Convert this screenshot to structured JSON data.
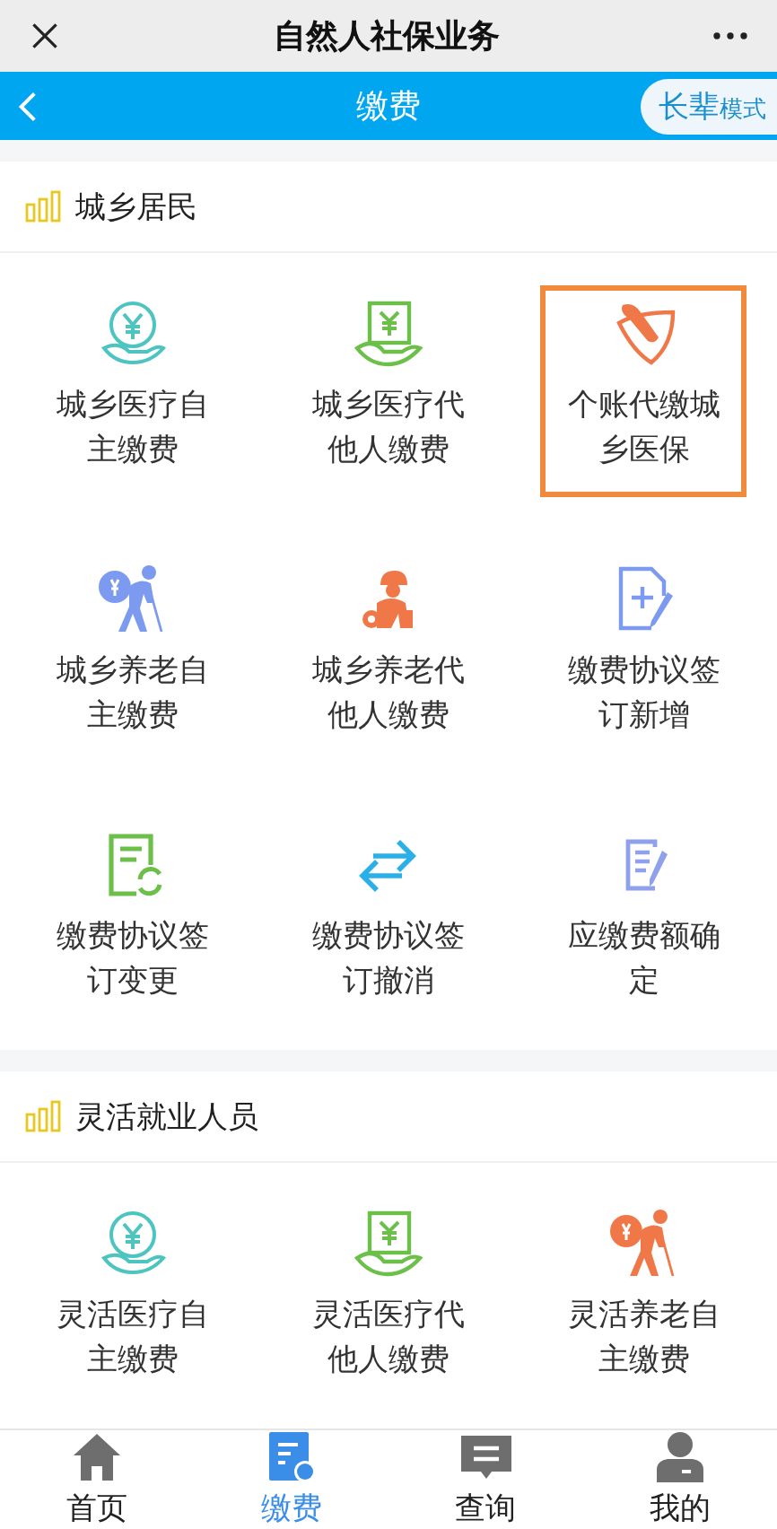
{
  "top_bar": {
    "title": "自然人社保业务"
  },
  "nav_bar": {
    "title": "缴费",
    "mode_button": {
      "big": "长辈",
      "small": "模式"
    }
  },
  "sections": [
    {
      "title": "城乡居民",
      "items": [
        {
          "label": "城乡医疗自主缴费",
          "kind": "yen-hand",
          "highlighted": false
        },
        {
          "label": "城乡医疗代他人缴费",
          "kind": "bill-hand",
          "highlighted": false
        },
        {
          "label": "个账代缴城乡医保",
          "kind": "pen-shield",
          "highlighted": true
        },
        {
          "label": "城乡养老自主缴费",
          "kind": "elder",
          "highlighted": false
        },
        {
          "label": "城乡养老代他人缴费",
          "kind": "worker",
          "highlighted": false
        },
        {
          "label": "缴费协议签订新增",
          "kind": "doc-plus",
          "highlighted": false
        },
        {
          "label": "缴费协议签订变更",
          "kind": "doc-refresh",
          "highlighted": false
        },
        {
          "label": "缴费协议签订撤消",
          "kind": "swap",
          "highlighted": false
        },
        {
          "label": "应缴费额确定",
          "kind": "doc-edit",
          "highlighted": false
        }
      ]
    },
    {
      "title": "灵活就业人员",
      "items": [
        {
          "label": "灵活医疗自主缴费",
          "kind": "yen-hand",
          "highlighted": false
        },
        {
          "label": "灵活医疗代他人缴费",
          "kind": "bill-hand",
          "highlighted": false
        },
        {
          "label": "灵活养老自主缴费",
          "kind": "elder-orange",
          "highlighted": false
        }
      ]
    }
  ],
  "tab_bar": [
    {
      "label": "首页",
      "kind": "home",
      "selected": false
    },
    {
      "label": "缴费",
      "kind": "pay",
      "selected": true
    },
    {
      "label": "查询",
      "kind": "query",
      "selected": false
    },
    {
      "label": "我的",
      "kind": "me",
      "selected": false
    }
  ]
}
